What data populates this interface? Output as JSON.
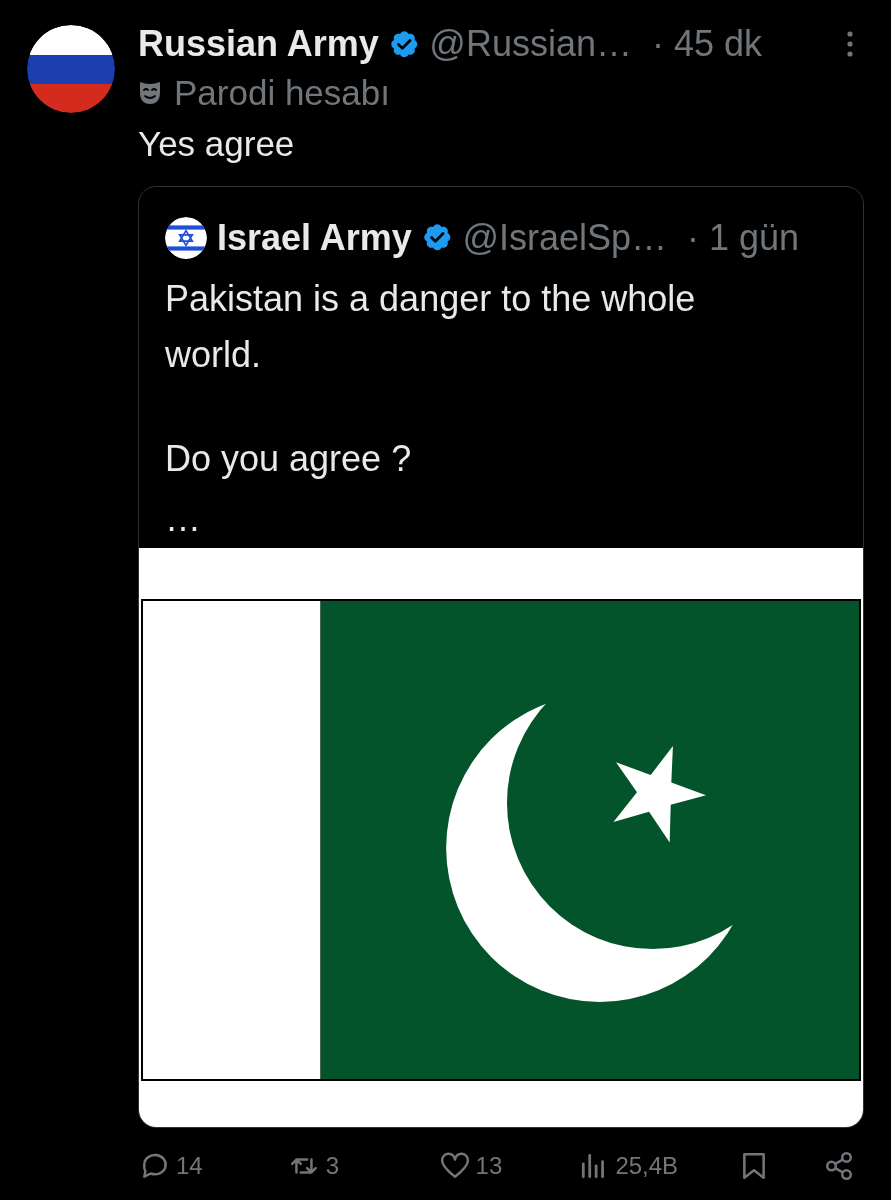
{
  "post": {
    "author": {
      "name": "Russian Army",
      "verified": true,
      "handle": "@Russian…",
      "time": "· 45 dk"
    },
    "account_label": "Parodi hesabı",
    "text": "Yes agree",
    "quote": {
      "author": {
        "name": "Israel Army",
        "verified": true,
        "handle": "@IsraelSp…",
        "time": "· 1 gün"
      },
      "paragraphs": [
        "Pakistan is a danger to the whole world.",
        "Do you agree ?",
        "…"
      ]
    },
    "actions": [
      {
        "kind": "reply",
        "count": "14"
      },
      {
        "kind": "repost",
        "count": "3"
      },
      {
        "kind": "like",
        "count": "13"
      },
      {
        "kind": "views",
        "count": "25,4B"
      },
      {
        "kind": "bookmark"
      },
      {
        "kind": "share"
      }
    ]
  }
}
